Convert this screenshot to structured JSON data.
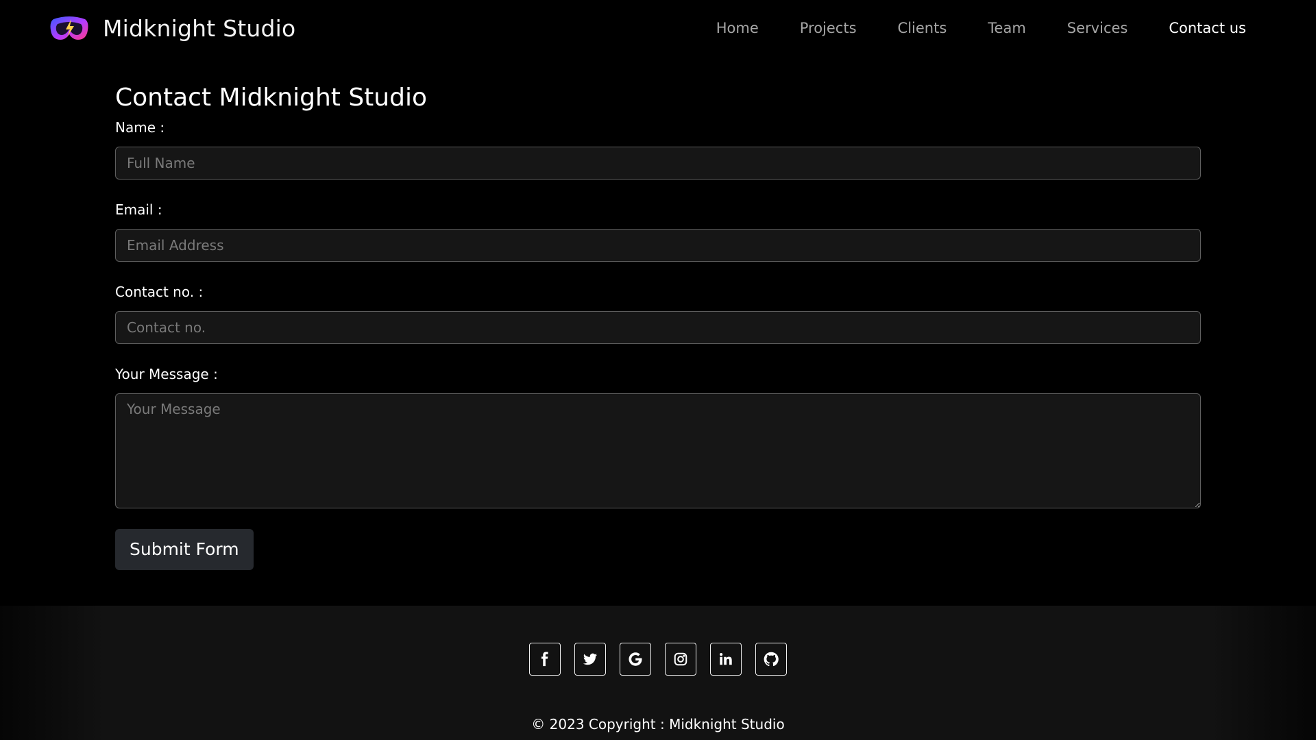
{
  "brand": {
    "name": "Midknight Studio",
    "logo_icon": "vr-headset-logo-icon",
    "logo_gradient": [
      "#3b5bff",
      "#b43bff",
      "#ff3b8a"
    ]
  },
  "nav": {
    "items": [
      {
        "label": "Home",
        "active": false
      },
      {
        "label": "Projects",
        "active": false
      },
      {
        "label": "Clients",
        "active": false
      },
      {
        "label": "Team",
        "active": false
      },
      {
        "label": "Services",
        "active": false
      },
      {
        "label": "Contact us",
        "active": true
      }
    ]
  },
  "form": {
    "title": "Contact Midknight Studio",
    "name": {
      "label": "Name :",
      "placeholder": "Full Name",
      "value": ""
    },
    "email": {
      "label": "Email :",
      "placeholder": "Email Address",
      "value": ""
    },
    "contact": {
      "label": "Contact no. :",
      "placeholder": "Contact no.",
      "value": ""
    },
    "message": {
      "label": "Your Message :",
      "placeholder": "Your Message",
      "value": ""
    },
    "submit_label": "Submit Form"
  },
  "footer": {
    "social": [
      {
        "name": "facebook-icon"
      },
      {
        "name": "twitter-icon"
      },
      {
        "name": "google-icon"
      },
      {
        "name": "instagram-icon"
      },
      {
        "name": "linkedin-icon"
      },
      {
        "name": "github-icon"
      }
    ],
    "copyright": "© 2023 Copyright : Midknight Studio"
  },
  "colors": {
    "background": "#000000",
    "input_bg": "#161616",
    "input_border": "#5e5e5e",
    "button_bg": "#26292e",
    "nav_inactive": "#a6a6a6",
    "nav_active": "#ffffff",
    "footer_bg": "#121212"
  }
}
